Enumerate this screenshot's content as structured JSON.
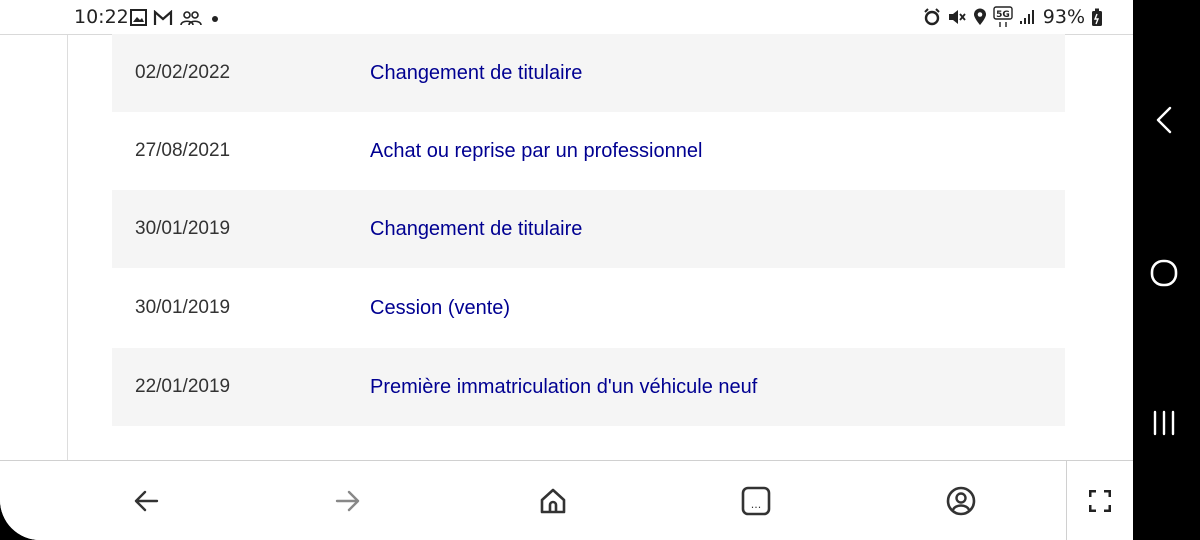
{
  "status_bar": {
    "time": "10:22",
    "battery": "93%",
    "network": "5G",
    "left_icons": [
      "gallery-icon",
      "gmail-icon",
      "people-icon",
      "dot-icon"
    ],
    "right_icons": [
      "alarm-icon",
      "mute-icon",
      "location-icon",
      "5g-icon",
      "signal-icon",
      "battery-icon"
    ]
  },
  "history": {
    "rows": [
      {
        "date": "02/02/2022",
        "operation": "Changement de titulaire"
      },
      {
        "date": "27/08/2021",
        "operation": "Achat ou reprise par un professionnel"
      },
      {
        "date": "30/01/2019",
        "operation": "Changement de titulaire"
      },
      {
        "date": "30/01/2019",
        "operation": "Cession (vente)"
      },
      {
        "date": "22/01/2019",
        "operation": "Première immatriculation d'un véhicule neuf"
      }
    ]
  },
  "toolbar": {
    "buttons": [
      "back-icon",
      "forward-icon",
      "home-icon",
      "tabs-icon",
      "account-icon",
      "fullscreen-icon"
    ],
    "tabs_label": "..."
  },
  "colors": {
    "link": "#000091",
    "row_shade": "#f5f5f5"
  }
}
